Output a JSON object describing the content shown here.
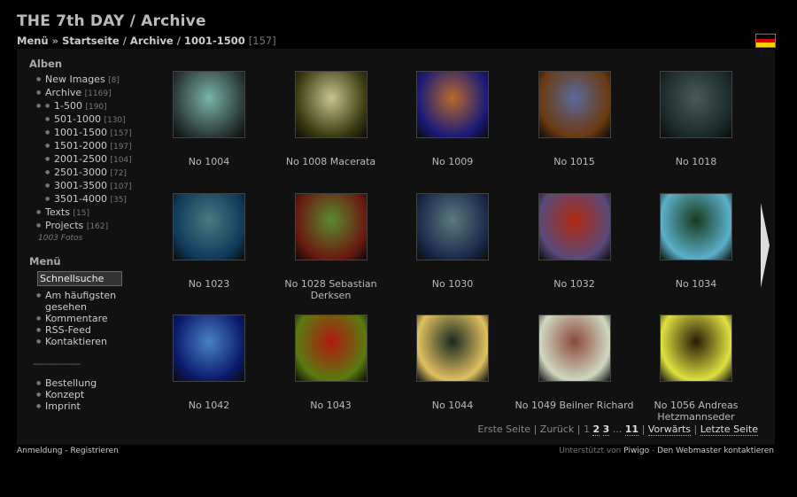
{
  "header": {
    "title": "THE 7th DAY / Archive",
    "breadcrumb": {
      "menu": "Menü",
      "sep1": "»",
      "home": "Startseite",
      "sep2": "/",
      "archive": "Archive",
      "sep3": "/",
      "current": "1001-1500",
      "count": "[157]"
    }
  },
  "flag": {
    "colors": [
      "#000000",
      "#dd0000",
      "#ffce00"
    ]
  },
  "sidebar": {
    "albums_title": "Alben",
    "albums": [
      {
        "label": "New Images",
        "count": "[8]"
      },
      {
        "label": "Archive",
        "count": "[1169]"
      }
    ],
    "sub_albums": [
      {
        "label": "1-500",
        "count": "[190]"
      },
      {
        "label": "501-1000",
        "count": "[130]"
      },
      {
        "label": "1001-1500",
        "count": "[157]"
      },
      {
        "label": "1501-2000",
        "count": "[197]"
      },
      {
        "label": "2001-2500",
        "count": "[104]"
      },
      {
        "label": "2501-3000",
        "count": "[72]"
      },
      {
        "label": "3001-3500",
        "count": "[107]"
      },
      {
        "label": "3501-4000",
        "count": "[35]"
      }
    ],
    "more_albums": [
      {
        "label": "Texts",
        "count": "[15]"
      },
      {
        "label": "Projects",
        "count": "[162]"
      }
    ],
    "total": "1003 Fotos",
    "menu_title": "Menü",
    "quicksearch": "Schnellsuche",
    "menu_items": [
      "Am häufigsten gesehen",
      "Kommentare",
      "RSS-Feed",
      "Kontaktieren"
    ],
    "divider": "------------------",
    "extra_items": [
      "Bestellung",
      "Konzept",
      "Imprint"
    ]
  },
  "thumbnails": [
    {
      "caption": "No 1004",
      "c1": "#2a3a38",
      "c2": "#7bb4a8"
    },
    {
      "caption": "No 1008 Macerata",
      "c1": "#3a3a10",
      "c2": "#c8c490"
    },
    {
      "caption": "No 1009",
      "c1": "#1a1a7a",
      "c2": "#b86a28"
    },
    {
      "caption": "No 1015",
      "c1": "#6a3a10",
      "c2": "#5a6a9a"
    },
    {
      "caption": "No 1018",
      "c1": "#1a2a2a",
      "c2": "#4a5a58"
    },
    {
      "caption": "No 1023",
      "c1": "#103a5a",
      "c2": "#4a7a80"
    },
    {
      "caption": "No 1028 Sebastian Derksen",
      "c1": "#6a1a10",
      "c2": "#5a8a30"
    },
    {
      "caption": "No 1030",
      "c1": "#1a2a4a",
      "c2": "#5a7a80"
    },
    {
      "caption": "No 1032",
      "c1": "#5a4a7a",
      "c2": "#b02a10"
    },
    {
      "caption": "No 1034",
      "c1": "#5ab0c8",
      "c2": "#1a3a20"
    },
    {
      "caption": "No 1042",
      "c1": "#0a1a6a",
      "c2": "#4a80c8"
    },
    {
      "caption": "No 1043",
      "c1": "#5a7a10",
      "c2": "#b01a10"
    },
    {
      "caption": "No 1044",
      "c1": "#e0c060",
      "c2": "#1a2a20"
    },
    {
      "caption": "No 1049 Beilner Richard",
      "c1": "#d0d8c0",
      "c2": "#8a4a3a"
    },
    {
      "caption": "No 1056 Andreas Hetzmannseder",
      "c1": "#e0e040",
      "c2": "#2a1a08"
    }
  ],
  "pager": {
    "first": "Erste Seite",
    "sep": "|",
    "prev": "Zurück",
    "page_current": "1",
    "p2": "2",
    "p3": "3",
    "ellipsis": "...",
    "p11": "11",
    "next": "Vorwärts",
    "last": "Letzte Seite"
  },
  "footer": {
    "login": "Anmeldung",
    "dash": "-",
    "register": "Registrieren",
    "powered": "Unterstützt von",
    "piwigo": "Piwigo",
    "contact": "Den Webmaster kontaktieren"
  }
}
